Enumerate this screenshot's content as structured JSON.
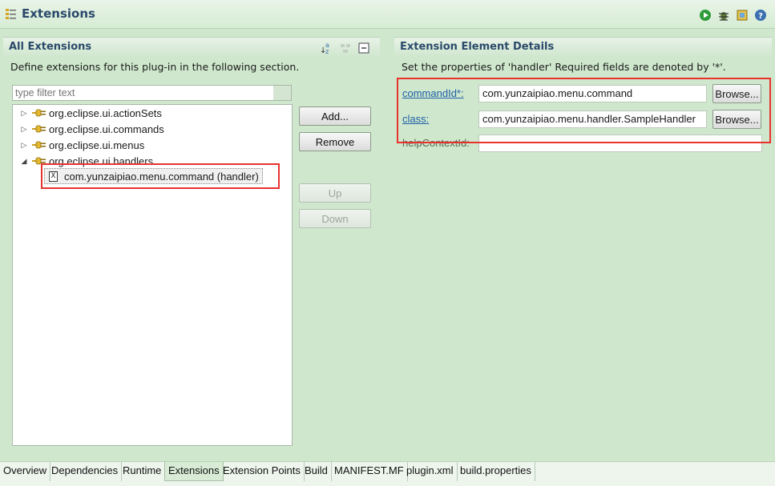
{
  "header": {
    "title": "Extensions",
    "icons": [
      "extensions-icon",
      "run-icon",
      "debug-icon",
      "export-icon",
      "help-icon"
    ]
  },
  "left": {
    "title": "All Extensions",
    "description": "Define extensions for this plug-in in the following section.",
    "filter_placeholder": "type filter text",
    "tree": [
      {
        "label": "org.eclipse.ui.actionSets",
        "expanded": false
      },
      {
        "label": "org.eclipse.ui.commands",
        "expanded": false
      },
      {
        "label": "org.eclipse.ui.menus",
        "expanded": false
      },
      {
        "label": "org.eclipse.ui.handlers",
        "expanded": true
      }
    ],
    "selected_child": "com.yunzaipiao.menu.command (handler)",
    "buttons": {
      "add": "Add...",
      "remove": "Remove",
      "up": "Up",
      "down": "Down"
    }
  },
  "right": {
    "title": "Extension Element Details",
    "description": "Set the properties of 'handler' Required fields are denoted by '*'.",
    "fields": [
      {
        "label": "commandId*:",
        "value": "com.yunzaipiao.menu.command",
        "browse": "Browse..."
      },
      {
        "label": "class:",
        "value": "com.yunzaipiao.menu.handler.SampleHandler",
        "browse": "Browse..."
      },
      {
        "label": "helpContextId:",
        "value": ""
      }
    ]
  },
  "tabs": [
    "Overview",
    "Dependencies",
    "Runtime",
    "Extensions",
    "Extension Points",
    "Build",
    "MANIFEST.MF",
    "plugin.xml",
    "build.properties"
  ],
  "active_tab": "Extensions",
  "colors": {
    "background": "#cfe8cd",
    "title": "#2b4a6b",
    "link": "#1f5fa8",
    "highlight": "#e8322e"
  }
}
